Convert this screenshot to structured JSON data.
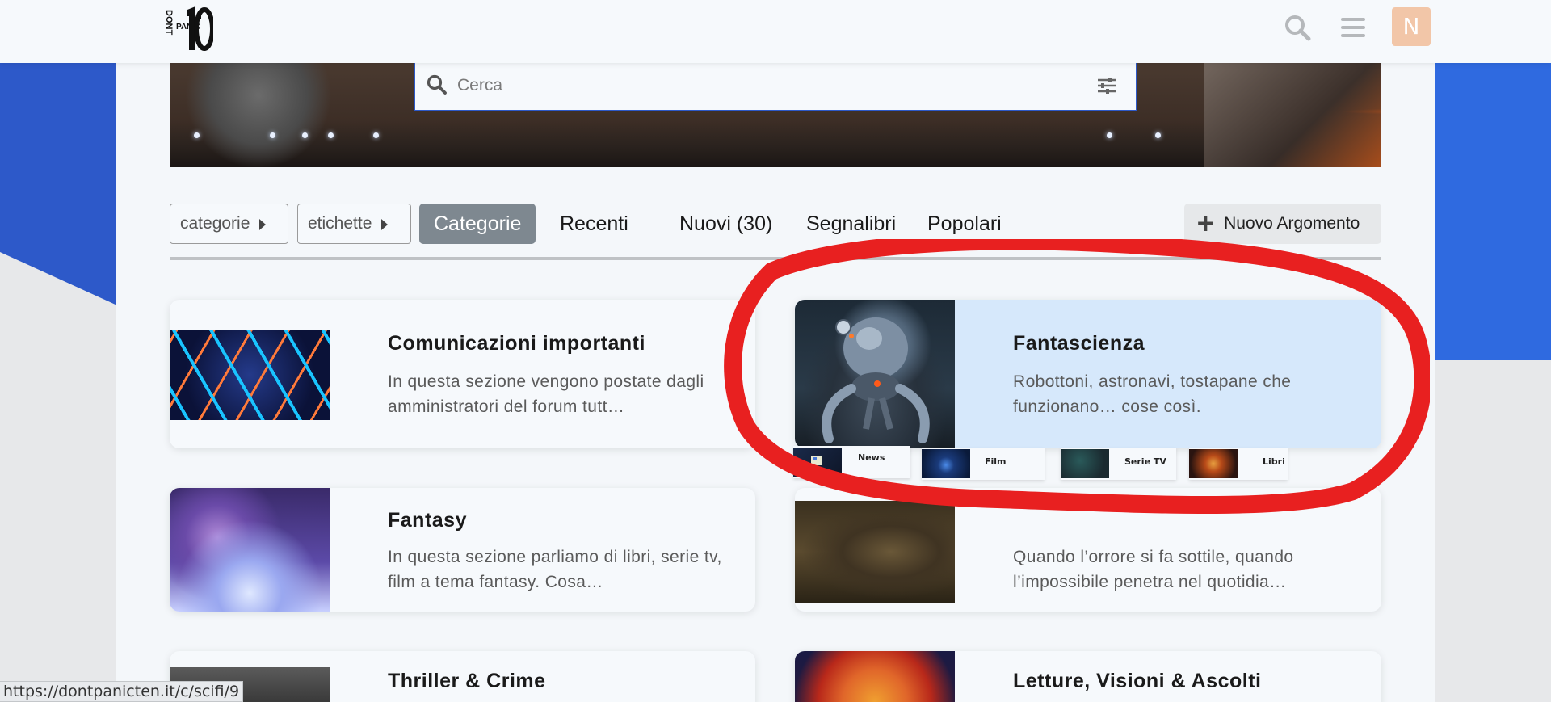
{
  "header": {
    "logo_alt": "DONT PANIC 10",
    "search_icon": "search-icon",
    "menu_icon": "hamburger-menu-icon",
    "avatar_letter": "N",
    "avatar_color": "#f2c6a8"
  },
  "search": {
    "placeholder": "Cerca"
  },
  "nav": {
    "dropdowns": [
      "categorie",
      "etichette"
    ],
    "tabs": [
      "Categorie",
      "Recenti",
      "Nuovi (30)",
      "Segnalibri",
      "Popolari"
    ],
    "active_tab": "Categorie",
    "new_topic_label": "Nuovo Argomento"
  },
  "categories": [
    {
      "title": "Comunicazioni importanti",
      "description": "In questa sezione vengono postate dagli amministratori del forum tutt…"
    },
    {
      "title": "Fantascienza",
      "description": "Robottoni, astronavi, tostapane che funzionano… cose così.",
      "subcategories": [
        "News",
        "Film",
        "Serie TV",
        "Libri"
      ]
    },
    {
      "title": "Fantasy",
      "description": "In questa sezione parliamo di libri, serie tv, film a tema fantasy. Cosa…"
    },
    {
      "title": "",
      "description": "Quando l’orrore si fa sottile, quando l’impossibile penetra nel quotidia…"
    },
    {
      "title": "Thriller & Crime",
      "description": ""
    },
    {
      "title": "Letture, Visioni & Ascolti",
      "description": ""
    }
  ],
  "status_bar": {
    "url": "https://dontpanicten.it/c/scifi/9"
  },
  "colors": {
    "accent_blue": "#2d59c9",
    "active_tab_bg": "#7e8890",
    "hover_card_bg": "#d6e8fb",
    "annotation_red": "#e82020"
  }
}
